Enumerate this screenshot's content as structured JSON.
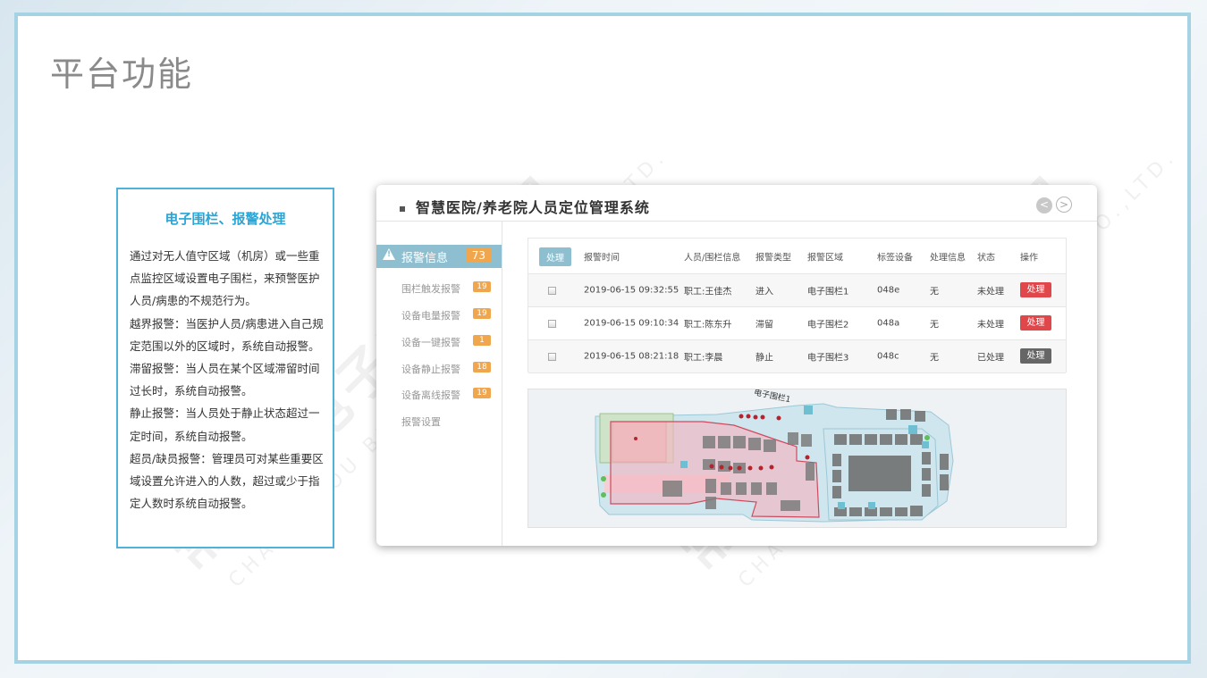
{
  "slide": {
    "title": "平台功能",
    "watermark": "常州本电子有限公司",
    "watermark_sub": "CHANGZHOU BENGBEN ELECTRIC CO.,LTD."
  },
  "info_card": {
    "title": "电子围栏、报警处理",
    "paragraphs": [
      "通过对无人值守区域（机房）或一些重点监控区域设置电子围栏，来预警医护人员/病患的不规范行为。",
      "越界报警：当医护人员/病患进入自己规定范围以外的区域时，系统自动报警。",
      "滞留报警：当人员在某个区域滞留时间过长时，系统自动报警。",
      "静止报警：当人员处于静止状态超过一定时间，系统自动报警。",
      "超员/缺员报警：管理员可对某些重要区域设置允许进入的人数，超过或少于指定人数时系统自动报警。"
    ]
  },
  "app": {
    "title": "智慧医院/养老院人员定位管理系统",
    "nav_prev": "<",
    "nav_next": ">",
    "sidebar": {
      "active": {
        "label": "报警信息",
        "count": "73"
      },
      "items": [
        {
          "label": "围栏触发报警",
          "count": "19"
        },
        {
          "label": "设备电量报警",
          "count": "19"
        },
        {
          "label": "设备一键报警",
          "count": "1"
        },
        {
          "label": "设备静止报警",
          "count": "18"
        },
        {
          "label": "设备离线报警",
          "count": "19"
        },
        {
          "label": "报警设置",
          "count": ""
        }
      ]
    },
    "table": {
      "header_button": "处理",
      "columns": [
        "报警时间",
        "人员/围栏信息",
        "报警类型",
        "报警区域",
        "标签设备",
        "处理信息",
        "状态",
        "操作"
      ],
      "rows": [
        {
          "time": "2019-06-15 09:32:55",
          "person": "职工:王佳杰",
          "type": "进入",
          "area": "电子围栏1",
          "tag": "048e",
          "info": "无",
          "status": "未处理",
          "action": "处理",
          "action_color": "#e0474b"
        },
        {
          "time": "2019-06-15 09:10:34",
          "person": "职工:陈东升",
          "type": "滞留",
          "area": "电子围栏2",
          "tag": "048a",
          "info": "无",
          "status": "未处理",
          "action": "处理",
          "action_color": "#e0474b"
        },
        {
          "time": "2019-06-15 08:21:18",
          "person": "职工:李晨",
          "type": "静止",
          "area": "电子围栏3",
          "tag": "048c",
          "info": "无",
          "status": "已处理",
          "action": "处理",
          "action_color": "#666666"
        }
      ]
    },
    "map": {
      "fence_label": "电子围栏1",
      "fence_fill": "#f2b6c0",
      "fence_stroke": "#d04a5e"
    }
  }
}
